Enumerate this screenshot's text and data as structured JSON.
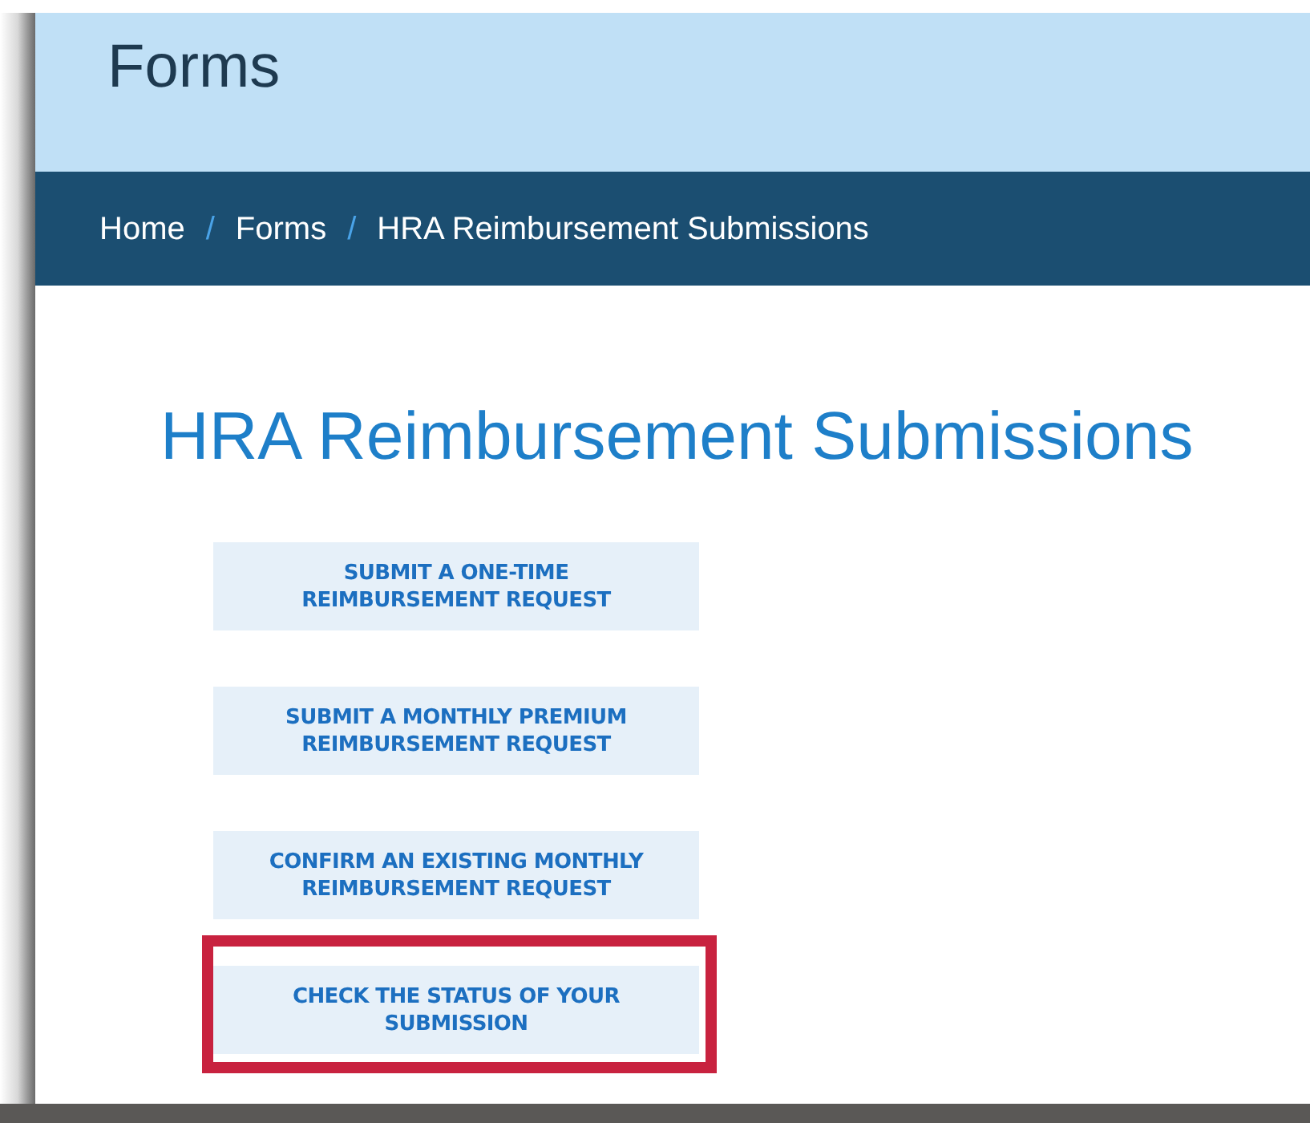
{
  "header": {
    "title": "Forms"
  },
  "breadcrumbs": [
    {
      "kind": "link",
      "label": "Home"
    },
    {
      "kind": "separator",
      "label": "/"
    },
    {
      "kind": "link",
      "label": "Forms"
    },
    {
      "kind": "separator",
      "label": "/"
    },
    {
      "kind": "current",
      "label": "HRA Reimbursement Submissions"
    }
  ],
  "page_title": "HRA Reimbursement Submissions",
  "buttons": [
    {
      "lines": [
        "SUBMIT A ONE-TIME",
        "REIMBURSEMENT REQUEST"
      ],
      "highlighted": false
    },
    {
      "lines": [
        "SUBMIT A MONTHLY PREMIUM",
        "REIMBURSEMENT REQUEST"
      ],
      "highlighted": false
    },
    {
      "lines": [
        "CONFIRM AN EXISTING MONTHLY",
        "REIMBURSEMENT REQUEST"
      ],
      "highlighted": false
    },
    {
      "lines": [
        "CHECK THE STATUS OF YOUR",
        "SUBMISSION"
      ],
      "highlighted": true
    }
  ]
}
